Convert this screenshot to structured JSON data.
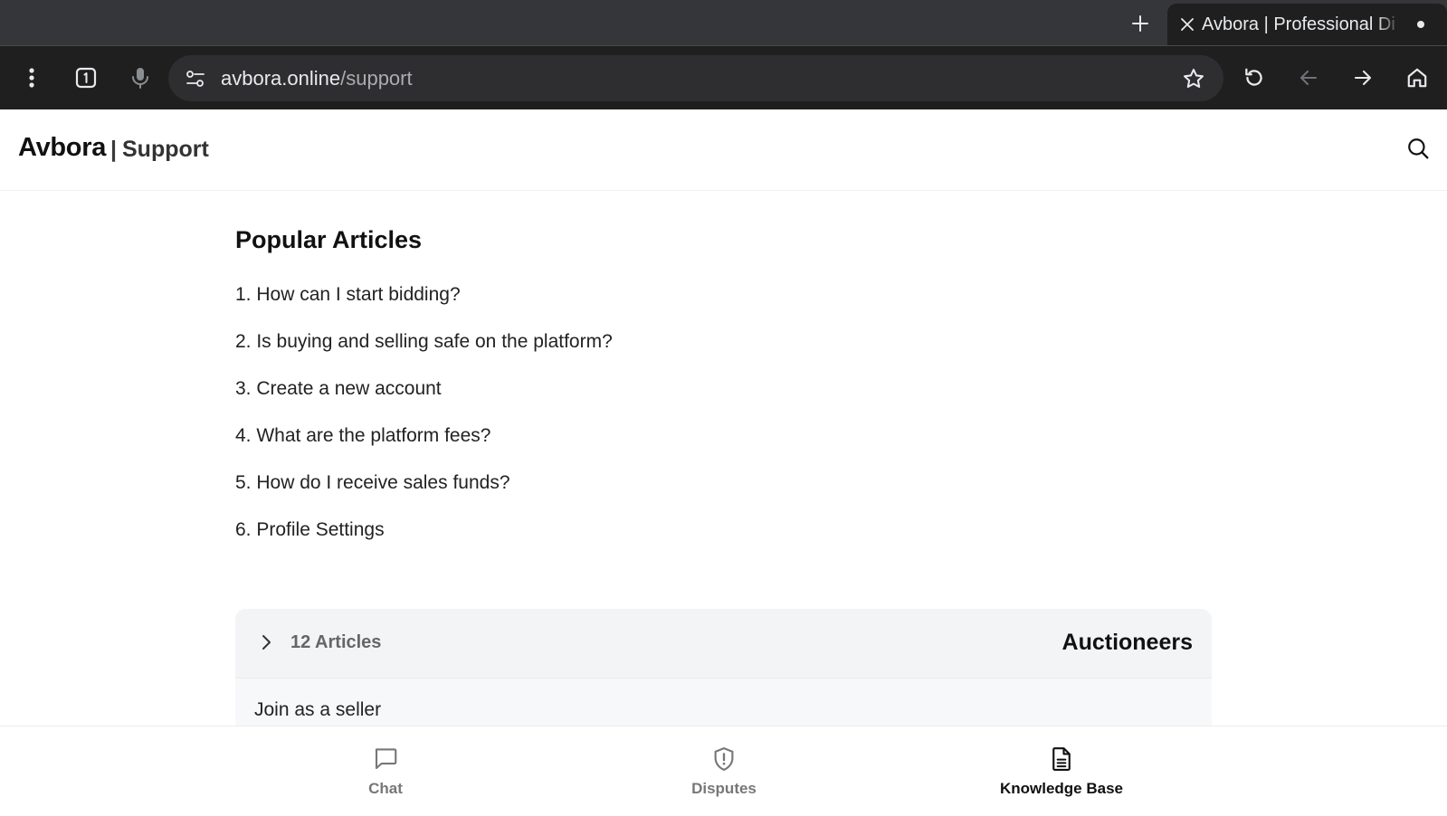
{
  "browser": {
    "tab_title": "Avbora | Professional Di",
    "url_host": "avbora.online",
    "url_path": "/support"
  },
  "header": {
    "brand": "Avbora",
    "separator": "|",
    "section": "Support"
  },
  "popular": {
    "title": "Popular Articles",
    "articles": [
      "1. How can I start bidding?",
      "2. Is buying and selling safe on the platform?",
      "3. Create a new account",
      "4. What are the platform fees?",
      "5. How do I receive sales funds?",
      "6. Profile Settings"
    ]
  },
  "category": {
    "count_label": "12 Articles",
    "name": "Auctioneers",
    "first_item": "Join as a seller"
  },
  "bottom_nav": {
    "items": [
      {
        "label": "Chat",
        "icon": "chat-bubble-icon"
      },
      {
        "label": "Disputes",
        "icon": "shield-alert-icon"
      },
      {
        "label": "Knowledge Base",
        "icon": "document-icon"
      }
    ],
    "active": "Knowledge Base"
  },
  "colors": {
    "chrome_dark": "#1f1f1f",
    "tabstrip": "#35363a",
    "text_primary": "#111111",
    "nav_inactive": "#777777"
  }
}
